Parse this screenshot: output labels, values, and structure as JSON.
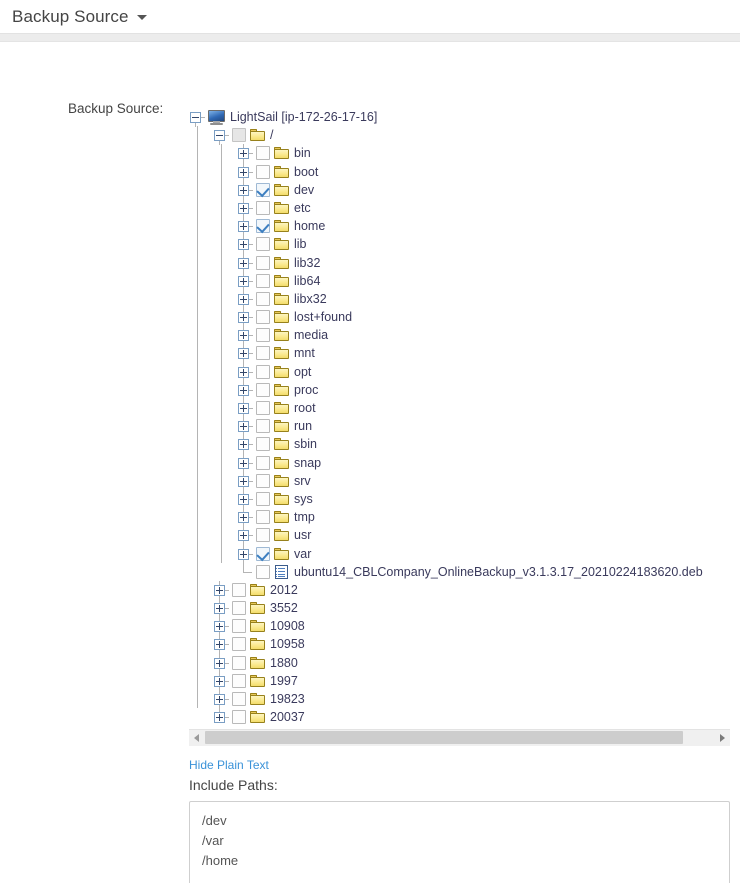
{
  "header": {
    "title": "Backup Source",
    "caret_icon": "caret-down-icon"
  },
  "form": {
    "field_label": "Backup Source:"
  },
  "tree": {
    "root": {
      "label": "LightSail [ip-172-26-17-16]",
      "icon": "monitor-icon",
      "expander": "minus",
      "checkbox": "none"
    },
    "nodes": [
      {
        "label": "/",
        "depth": 1,
        "icon": "folder-icon",
        "expander": "minus",
        "checkbox": "disabled",
        "last": false
      },
      {
        "label": "bin",
        "depth": 2,
        "icon": "folder-icon",
        "expander": "plus",
        "checkbox": "unchecked",
        "last": false
      },
      {
        "label": "boot",
        "depth": 2,
        "icon": "folder-icon",
        "expander": "plus",
        "checkbox": "unchecked",
        "last": false
      },
      {
        "label": "dev",
        "depth": 2,
        "icon": "folder-icon",
        "expander": "plus",
        "checkbox": "checked",
        "last": false
      },
      {
        "label": "etc",
        "depth": 2,
        "icon": "folder-icon",
        "expander": "plus",
        "checkbox": "unchecked",
        "last": false
      },
      {
        "label": "home",
        "depth": 2,
        "icon": "folder-icon",
        "expander": "plus",
        "checkbox": "checked",
        "last": false
      },
      {
        "label": "lib",
        "depth": 2,
        "icon": "folder-icon",
        "expander": "plus",
        "checkbox": "unchecked",
        "last": false
      },
      {
        "label": "lib32",
        "depth": 2,
        "icon": "folder-icon",
        "expander": "plus",
        "checkbox": "unchecked",
        "last": false
      },
      {
        "label": "lib64",
        "depth": 2,
        "icon": "folder-icon",
        "expander": "plus",
        "checkbox": "unchecked",
        "last": false
      },
      {
        "label": "libx32",
        "depth": 2,
        "icon": "folder-icon",
        "expander": "plus",
        "checkbox": "unchecked",
        "last": false
      },
      {
        "label": "lost+found",
        "depth": 2,
        "icon": "folder-icon",
        "expander": "plus",
        "checkbox": "unchecked",
        "last": false
      },
      {
        "label": "media",
        "depth": 2,
        "icon": "folder-icon",
        "expander": "plus",
        "checkbox": "unchecked",
        "last": false
      },
      {
        "label": "mnt",
        "depth": 2,
        "icon": "folder-icon",
        "expander": "plus",
        "checkbox": "unchecked",
        "last": false
      },
      {
        "label": "opt",
        "depth": 2,
        "icon": "folder-icon",
        "expander": "plus",
        "checkbox": "unchecked",
        "last": false
      },
      {
        "label": "proc",
        "depth": 2,
        "icon": "folder-icon",
        "expander": "plus",
        "checkbox": "unchecked",
        "last": false
      },
      {
        "label": "root",
        "depth": 2,
        "icon": "folder-icon",
        "expander": "plus",
        "checkbox": "unchecked",
        "last": false
      },
      {
        "label": "run",
        "depth": 2,
        "icon": "folder-icon",
        "expander": "plus",
        "checkbox": "unchecked",
        "last": false
      },
      {
        "label": "sbin",
        "depth": 2,
        "icon": "folder-icon",
        "expander": "plus",
        "checkbox": "unchecked",
        "last": false
      },
      {
        "label": "snap",
        "depth": 2,
        "icon": "folder-icon",
        "expander": "plus",
        "checkbox": "unchecked",
        "last": false
      },
      {
        "label": "srv",
        "depth": 2,
        "icon": "folder-icon",
        "expander": "plus",
        "checkbox": "unchecked",
        "last": false
      },
      {
        "label": "sys",
        "depth": 2,
        "icon": "folder-icon",
        "expander": "plus",
        "checkbox": "unchecked",
        "last": false
      },
      {
        "label": "tmp",
        "depth": 2,
        "icon": "folder-icon",
        "expander": "plus",
        "checkbox": "unchecked",
        "last": false
      },
      {
        "label": "usr",
        "depth": 2,
        "icon": "folder-icon",
        "expander": "plus",
        "checkbox": "unchecked",
        "last": false
      },
      {
        "label": "var",
        "depth": 2,
        "icon": "folder-icon",
        "expander": "plus",
        "checkbox": "checked",
        "last": false
      },
      {
        "label": "ubuntu14_CBLCompany_OnlineBackup_v3.1.3.17_20210224183620.deb",
        "depth": 2,
        "icon": "file-icon",
        "expander": "none",
        "checkbox": "unchecked",
        "last": true
      },
      {
        "label": "2012",
        "depth": 1,
        "icon": "folder-icon",
        "expander": "plus",
        "checkbox": "unchecked",
        "last": false
      },
      {
        "label": "3552",
        "depth": 1,
        "icon": "folder-icon",
        "expander": "plus",
        "checkbox": "unchecked",
        "last": false
      },
      {
        "label": "10908",
        "depth": 1,
        "icon": "folder-icon",
        "expander": "plus",
        "checkbox": "unchecked",
        "last": false
      },
      {
        "label": "10958",
        "depth": 1,
        "icon": "folder-icon",
        "expander": "plus",
        "checkbox": "unchecked",
        "last": false
      },
      {
        "label": "1880",
        "depth": 1,
        "icon": "folder-icon",
        "expander": "plus",
        "checkbox": "unchecked",
        "last": false
      },
      {
        "label": "1997",
        "depth": 1,
        "icon": "folder-icon",
        "expander": "plus",
        "checkbox": "unchecked",
        "last": false
      },
      {
        "label": "19823",
        "depth": 1,
        "icon": "folder-icon",
        "expander": "plus",
        "checkbox": "unchecked",
        "last": false
      },
      {
        "label": "20037",
        "depth": 1,
        "icon": "folder-icon",
        "expander": "plus",
        "checkbox": "unchecked",
        "last": false
      }
    ]
  },
  "scrollbar": {
    "left_arrow_icon": "arrow-left-icon",
    "right_arrow_icon": "arrow-right-icon",
    "thumb_position_percent": 0
  },
  "below": {
    "hide_plain_text": "Hide Plain Text",
    "include_paths_label": "Include Paths:",
    "include_paths": [
      "/dev",
      "/var",
      "/home"
    ]
  },
  "colors": {
    "link": "#3a92d8",
    "checkbox_tick": "#3d7fc1",
    "folder": "#f3dc6b",
    "tree_text": "#3a3a5c"
  }
}
